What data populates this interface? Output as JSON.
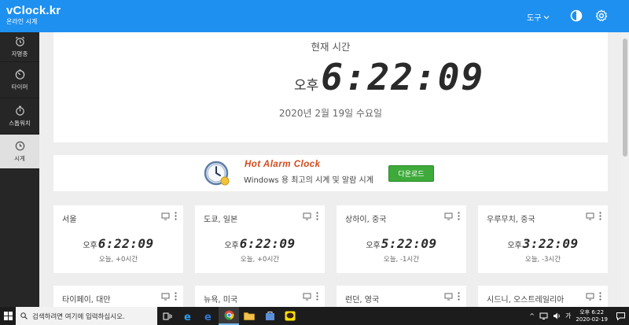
{
  "header": {
    "brand_title": "vClock.kr",
    "brand_subtitle": "온라인 시계",
    "tools_label": "도구",
    "theme_icon": "contrast-icon",
    "settings_icon": "gear-icon",
    "bg_color": "#1e90f0"
  },
  "sidebar": {
    "items": [
      {
        "label": "자명종",
        "icon": "alarm-clock-icon",
        "active": false
      },
      {
        "label": "타이머",
        "icon": "timer-icon",
        "active": false
      },
      {
        "label": "스톱워치",
        "icon": "stopwatch-icon",
        "active": false
      },
      {
        "label": "시계",
        "icon": "clock-icon",
        "active": true
      }
    ]
  },
  "clock": {
    "label": "현재 시간",
    "ampm": "오후",
    "time": "6:22:09",
    "date": "2020년 2월 19일 수요일"
  },
  "ad": {
    "title": "Hot Alarm Clock",
    "subtitle": "Windows 용 최고의 시계 및 알람 시계",
    "button": "다운로드"
  },
  "cities": [
    {
      "name": "서울",
      "ampm": "오후",
      "time": "6:22:09",
      "diff": "오늘, +0시간"
    },
    {
      "name": "도쿄, 일본",
      "ampm": "오후",
      "time": "6:22:09",
      "diff": "오늘, +0시간"
    },
    {
      "name": "상하이, 중국",
      "ampm": "오후",
      "time": "5:22:09",
      "diff": "오늘, -1시간"
    },
    {
      "name": "우루무치, 중국",
      "ampm": "오후",
      "time": "3:22:09",
      "diff": "오늘, -3시간"
    },
    {
      "name": "타이페이, 대만"
    },
    {
      "name": "뉴욕, 미국"
    },
    {
      "name": "런던, 영국"
    },
    {
      "name": "시드니, 오스트레일리아"
    }
  ],
  "taskbar": {
    "search_placeholder": "검색하려면 여기에 입력하십시오.",
    "tray_lang": "가",
    "tray_time": "오후 6:22",
    "tray_date": "2020-02-19"
  }
}
